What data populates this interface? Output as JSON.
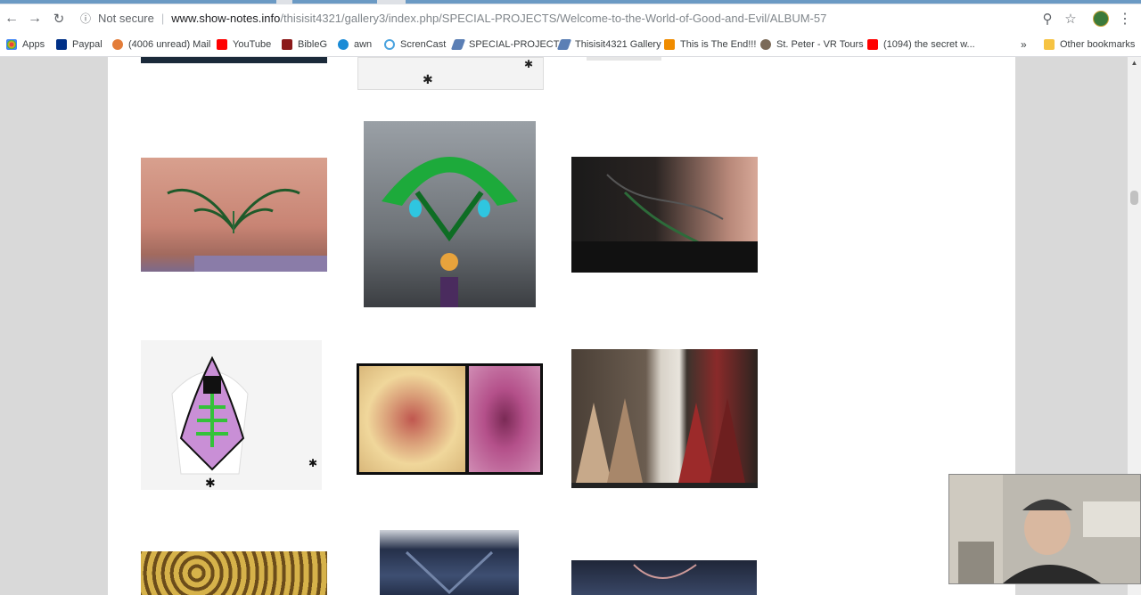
{
  "browser": {
    "security_label": "Not secure",
    "url_host": "www.show-notes.info",
    "url_path": "/thisisit4321/gallery3/index.php/SPECIAL-PROJECTS/Welcome-to-the-World-of-Good-and-Evil/ALBUM-57"
  },
  "bookmarks": [
    {
      "label": "Apps",
      "icon": "apps-grid-icon",
      "color": "#e8453c"
    },
    {
      "label": "Paypal",
      "icon": "paypal-icon",
      "color": "#003087"
    },
    {
      "label": "(4006 unread) Mail",
      "icon": "mail-icon",
      "color": "#e37d3a"
    },
    {
      "label": "YouTube",
      "icon": "youtube-icon",
      "color": "#ff0000"
    },
    {
      "label": "BibleG",
      "icon": "bible-icon",
      "color": "#8b1a1a"
    },
    {
      "label": "awn",
      "icon": "awn-icon",
      "color": "#1a8bd6"
    },
    {
      "label": "ScrenCast",
      "icon": "screencast-icon",
      "color": "#4aa3df"
    },
    {
      "label": "SPECIAL-PROJECTS",
      "icon": "gallery-icon",
      "color": "#5b7fb5"
    },
    {
      "label": "Thisisit4321 Gallery",
      "icon": "gallery-icon",
      "color": "#5b7fb5"
    },
    {
      "label": "This is The End!!!",
      "icon": "rss-icon",
      "color": "#f08c00"
    },
    {
      "label": "St. Peter - VR Tours",
      "icon": "vr-icon",
      "color": "#7b6a58"
    },
    {
      "label": "(1094) the secret w...",
      "icon": "youtube-icon",
      "color": "#ff0000"
    }
  ],
  "bookmarks_overflow": "»",
  "other_bookmarks": "Other bookmarks",
  "gallery": {
    "thumbnails": [
      {
        "name": "thumb-partial-top-1",
        "desc": "cropped dark screenshot",
        "palette": [
          "#1b2a3a",
          "#2f4d6b"
        ]
      },
      {
        "name": "thumb-partial-top-2",
        "desc": "white shirt sketch",
        "palette": [
          "#f3f3f3",
          "#cccccc"
        ]
      },
      {
        "name": "thumb-partial-top-3",
        "desc": "faint caption",
        "palette": [
          "#ffffff",
          "#e6e6e6"
        ]
      },
      {
        "name": "thumb-tattoo-belly",
        "desc": "green tribal tattoo",
        "palette": [
          "#d49a88",
          "#b06d5f"
        ]
      },
      {
        "name": "thumb-green-arch",
        "desc": "green arch cathedral",
        "palette": [
          "#7b8088",
          "#19a33a"
        ]
      },
      {
        "name": "thumb-lace-tattoo",
        "desc": "dark lace tattoo",
        "palette": [
          "#1c1c1c",
          "#c79a88"
        ]
      },
      {
        "name": "thumb-skeleton-shirt",
        "desc": "skeleton t-shirt print",
        "palette": [
          "#f2f2f2",
          "#b46ac2"
        ]
      },
      {
        "name": "thumb-art-diptych",
        "desc": "two painted panels",
        "palette": [
          "#e5c58a",
          "#b7478d"
        ]
      },
      {
        "name": "thumb-shop-window",
        "desc": "boutique window dresses",
        "palette": [
          "#3d352f",
          "#9f2c2c"
        ]
      },
      {
        "name": "thumb-gold-embroidery",
        "desc": "gold embroidery",
        "palette": [
          "#3b2b14",
          "#d6b24a"
        ]
      },
      {
        "name": "thumb-sequin-dress",
        "desc": "sequined dark dress",
        "palette": [
          "#25304a",
          "#7385a8"
        ]
      },
      {
        "name": "thumb-beaded-neckline",
        "desc": "beaded neckline",
        "palette": [
          "#1f2638",
          "#6a7aa0"
        ]
      }
    ]
  },
  "webcam": {
    "label": "presenter webcam overlay"
  }
}
